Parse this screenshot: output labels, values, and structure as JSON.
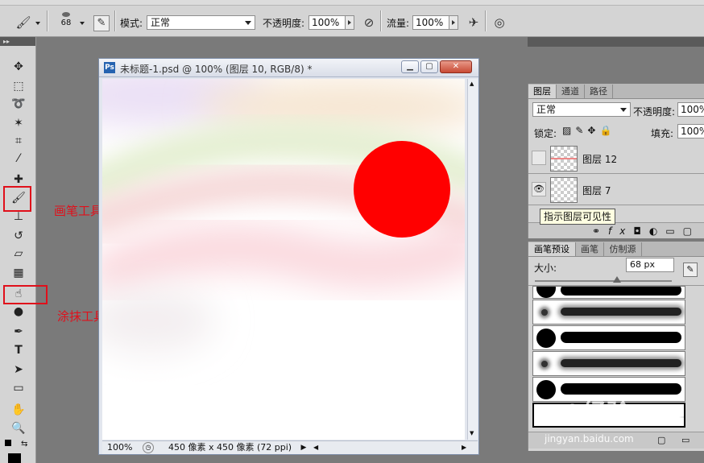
{
  "options_bar": {
    "brush_size": "68",
    "mode_label": "模式:",
    "mode_value": "正常",
    "opacity_label": "不透明度:",
    "opacity_value": "100%",
    "flow_label": "流量:",
    "flow_value": "100%"
  },
  "toolbox": {
    "collapse_glyph": "▸▸",
    "annotations": [
      "画笔工具",
      "涂抹工具"
    ]
  },
  "document": {
    "title": "未标题-1.psd @ 100% (图层 10, RGB/8) *",
    "ps_badge": "Ps",
    "status_zoom": "100%",
    "status_info": "450 像素 x 450 像素 (72 ppi)",
    "red_circle_color": "#ff0000"
  },
  "layers_panel": {
    "tabs": [
      "图层",
      "通道",
      "路径"
    ],
    "blend_mode": "正常",
    "opacity_label": "不透明度:",
    "opacity_value": "100%",
    "lock_label": "锁定:",
    "fill_label": "填充:",
    "fill_value": "100%",
    "layers": [
      {
        "name": "图层 12",
        "visible": false
      },
      {
        "name": "图层 7",
        "visible": true
      }
    ],
    "tooltip": "指示图层可见性"
  },
  "brushes_panel": {
    "tabs": [
      "画笔预设",
      "画笔",
      "仿制源"
    ],
    "size_label": "大小:",
    "size_value": "68 px"
  },
  "watermark": {
    "text": "Bai 经验",
    "url": "jingyan.baidu.com"
  }
}
